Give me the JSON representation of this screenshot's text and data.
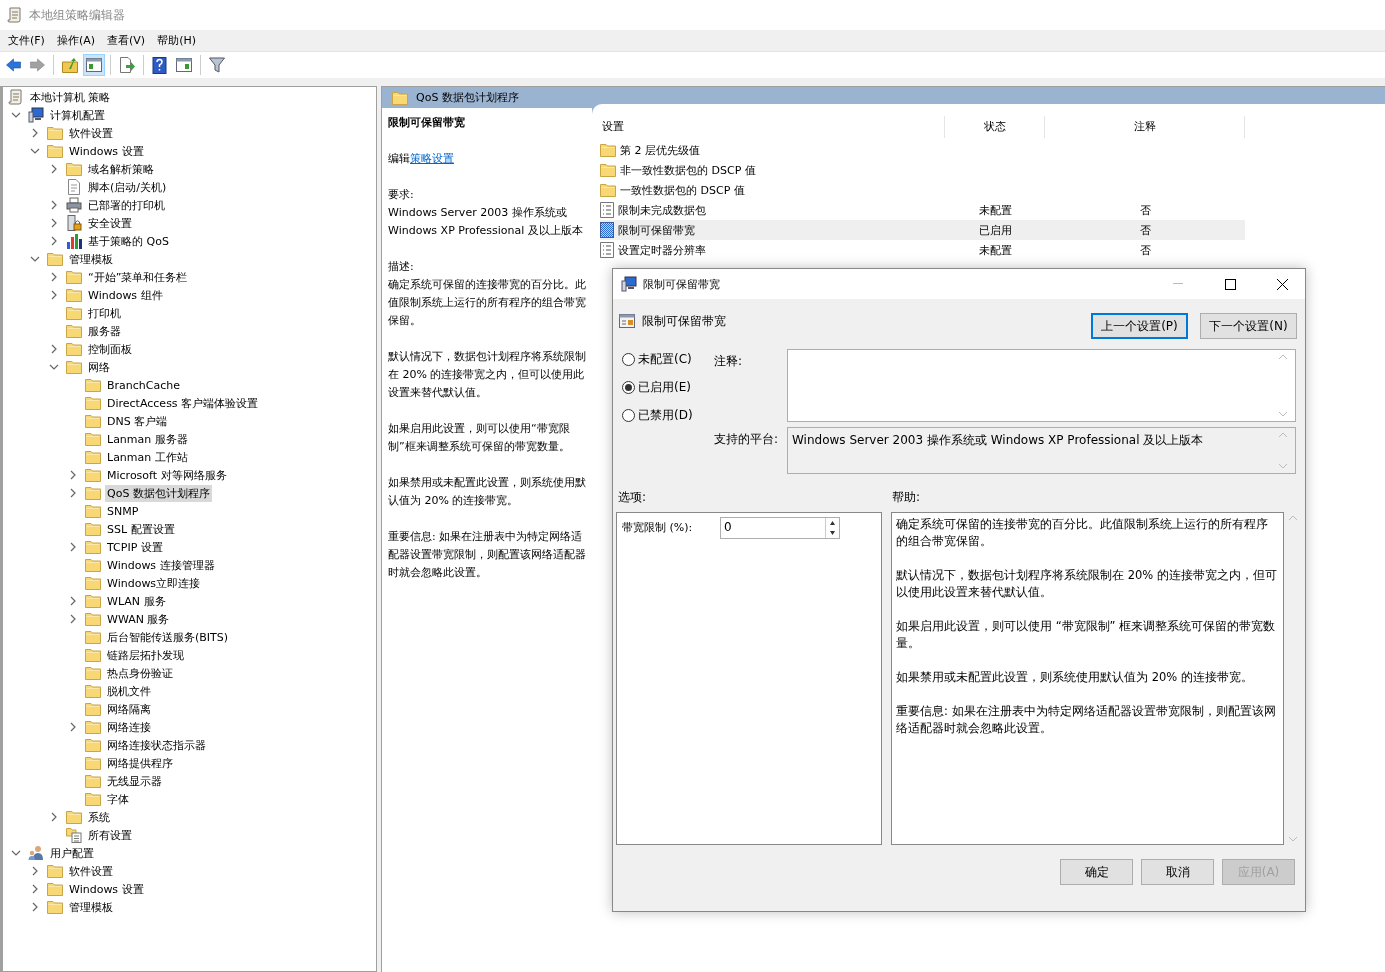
{
  "window": {
    "title": "本地组策略编辑器"
  },
  "menu": [
    {
      "label": "文件(F)"
    },
    {
      "label": "操作(A)"
    },
    {
      "label": "查看(V)"
    },
    {
      "label": "帮助(H)"
    }
  ],
  "toolbar": [
    [
      {
        "kind": "back",
        "disabled": false,
        "pressed": false
      },
      {
        "kind": "forward",
        "disabled": true,
        "pressed": false
      }
    ],
    [
      {
        "kind": "up",
        "disabled": false,
        "pressed": false
      },
      {
        "kind": "console-tree",
        "disabled": false,
        "pressed": true
      }
    ],
    [
      {
        "kind": "export",
        "disabled": false,
        "pressed": false
      }
    ],
    [
      {
        "kind": "help",
        "disabled": false,
        "pressed": false
      },
      {
        "kind": "action-pane",
        "disabled": false,
        "pressed": false
      }
    ],
    [
      {
        "kind": "filter",
        "disabled": false,
        "pressed": false
      }
    ]
  ],
  "tree": [
    {
      "label": "本地计算机 策略",
      "kind": "policy-root",
      "selected": false,
      "children": [
        {
          "label": "计算机配置",
          "kind": "computer",
          "selected": false,
          "expanded": true,
          "children": [
            {
              "label": "软件设置",
              "kind": "folder",
              "selected": false,
              "expanded": false
            },
            {
              "label": "Windows 设置",
              "kind": "folder",
              "selected": false,
              "expanded": true,
              "children": [
                {
                  "label": "域名解析策略",
                  "kind": "folder",
                  "selected": false,
                  "expanded": false
                },
                {
                  "label": "脚本(启动/关机)",
                  "kind": "script",
                  "selected": false
                },
                {
                  "label": "已部署的打印机",
                  "kind": "printer",
                  "selected": false,
                  "expanded": false
                },
                {
                  "label": "安全设置",
                  "kind": "security",
                  "selected": false,
                  "expanded": false
                },
                {
                  "label": "基于策略的 QoS",
                  "kind": "chart",
                  "selected": false,
                  "expanded": false
                }
              ]
            },
            {
              "label": "管理模板",
              "kind": "folder",
              "selected": false,
              "expanded": true,
              "children": [
                {
                  "label": "“开始”菜单和任务栏",
                  "kind": "folder",
                  "selected": false,
                  "expanded": false
                },
                {
                  "label": "Windows 组件",
                  "kind": "folder",
                  "selected": false,
                  "expanded": false
                },
                {
                  "label": "打印机",
                  "kind": "folder",
                  "selected": false
                },
                {
                  "label": "服务器",
                  "kind": "folder",
                  "selected": false
                },
                {
                  "label": "控制面板",
                  "kind": "folder",
                  "selected": false,
                  "expanded": false
                },
                {
                  "label": "网络",
                  "kind": "folder",
                  "selected": false,
                  "expanded": true,
                  "children": [
                    {
                      "label": "BranchCache",
                      "kind": "folder",
                      "selected": false
                    },
                    {
                      "label": "DirectAccess 客户端体验设置",
                      "kind": "folder",
                      "selected": false
                    },
                    {
                      "label": "DNS 客户端",
                      "kind": "folder",
                      "selected": false
                    },
                    {
                      "label": "Lanman 服务器",
                      "kind": "folder",
                      "selected": false
                    },
                    {
                      "label": "Lanman 工作站",
                      "kind": "folder",
                      "selected": false
                    },
                    {
                      "label": "Microsoft 对等网络服务",
                      "kind": "folder",
                      "selected": false,
                      "expanded": false
                    },
                    {
                      "label": "QoS 数据包计划程序",
                      "kind": "folder",
                      "selected": true,
                      "expanded": false
                    },
                    {
                      "label": "SNMP",
                      "kind": "folder",
                      "selected": false
                    },
                    {
                      "label": "SSL 配置设置",
                      "kind": "folder",
                      "selected": false
                    },
                    {
                      "label": "TCPIP 设置",
                      "kind": "folder",
                      "selected": false,
                      "expanded": false
                    },
                    {
                      "label": "Windows 连接管理器",
                      "kind": "folder",
                      "selected": false
                    },
                    {
                      "label": "Windows立即连接",
                      "kind": "folder",
                      "selected": false
                    },
                    {
                      "label": "WLAN 服务",
                      "kind": "folder",
                      "selected": false,
                      "expanded": false
                    },
                    {
                      "label": "WWAN 服务",
                      "kind": "folder",
                      "selected": false,
                      "expanded": false
                    },
                    {
                      "label": "后台智能传送服务(BITS)",
                      "kind": "folder",
                      "selected": false
                    },
                    {
                      "label": "链路层拓扑发现",
                      "kind": "folder",
                      "selected": false
                    },
                    {
                      "label": "热点身份验证",
                      "kind": "folder",
                      "selected": false
                    },
                    {
                      "label": "脱机文件",
                      "kind": "folder",
                      "selected": false
                    },
                    {
                      "label": "网络隔离",
                      "kind": "folder",
                      "selected": false
                    },
                    {
                      "label": "网络连接",
                      "kind": "folder",
                      "selected": false,
                      "expanded": false
                    },
                    {
                      "label": "网络连接状态指示器",
                      "kind": "folder",
                      "selected": false
                    },
                    {
                      "label": "网络提供程序",
                      "kind": "folder",
                      "selected": false
                    },
                    {
                      "label": "无线显示器",
                      "kind": "folder",
                      "selected": false
                    },
                    {
                      "label": "字体",
                      "kind": "folder",
                      "selected": false
                    }
                  ]
                },
                {
                  "label": "系统",
                  "kind": "folder",
                  "selected": false,
                  "expanded": false
                },
                {
                  "label": "所有设置",
                  "kind": "all-settings",
                  "selected": false
                }
              ]
            }
          ]
        },
        {
          "label": "用户配置",
          "kind": "user",
          "selected": false,
          "expanded": true,
          "children": [
            {
              "label": "软件设置",
              "kind": "folder",
              "selected": false,
              "expanded": false
            },
            {
              "label": "Windows 设置",
              "kind": "folder",
              "selected": false,
              "expanded": false
            },
            {
              "label": "管理模板",
              "kind": "folder",
              "selected": false,
              "expanded": false
            }
          ]
        }
      ]
    }
  ],
  "pane": {
    "title": "QoS 数据包计划程序"
  },
  "details": {
    "heading": "限制可保留带宽",
    "edit_prefix": "编辑",
    "edit_link": "策略设置",
    "requirements_label": "要求:",
    "requirements": "Windows Server 2003 操作系统或 Windows XP Professional 及以上版本",
    "description_label": "描述:",
    "paragraphs": [
      "确定系统可保留的连接带宽的百分比。此值限制系统上运行的所有程序的组合带宽保留。",
      "默认情况下，数据包计划程序将系统限制在 20% 的连接带宽之内，但可以使用此设置来替代默认值。",
      "如果启用此设置，则可以使用“带宽限制”框来调整系统可保留的带宽数量。",
      "如果禁用或未配置此设置，则系统使用默认值为 20% 的连接带宽。",
      "重要信息: 如果在注册表中为特定网络适配器设置带宽限制，则配置该网络适配器时就会忽略此设置。"
    ]
  },
  "table": {
    "columns": [
      "设置",
      "状态",
      "注释"
    ],
    "rows": [
      {
        "kind": "folder",
        "name": "第 2 层优先级值",
        "selected": false
      },
      {
        "kind": "folder",
        "name": "非一致性数据包的 DSCP 值",
        "selected": false
      },
      {
        "kind": "folder",
        "name": "一致性数据包的 DSCP 值",
        "selected": false
      },
      {
        "kind": "setting",
        "name": "限制未完成数据包",
        "state": "未配置",
        "comment": "否",
        "selected": false
      },
      {
        "kind": "setting-enabled",
        "name": "限制可保留带宽",
        "state": "已启用",
        "comment": "否",
        "selected": true
      },
      {
        "kind": "setting",
        "name": "设置定时器分辨率",
        "state": "未配置",
        "comment": "否",
        "selected": false
      }
    ]
  },
  "dialog": {
    "title": "限制可保留带宽",
    "setting_name": "限制可保留带宽",
    "nav_buttons": [
      {
        "label": "上一个设置(P)",
        "focused": true
      },
      {
        "label": "下一个设置(N)",
        "focused": false
      }
    ],
    "options": [
      {
        "label": "未配置(C)",
        "selected": false
      },
      {
        "label": "已启用(E)",
        "selected": true
      },
      {
        "label": "已禁用(D)",
        "selected": false
      }
    ],
    "comment_label": "注释:",
    "platform_label": "支持的平台:",
    "platform": "Windows Server 2003 操作系统或 Windows XP Professional 及以上版本",
    "options_label": "选项:",
    "help_label": "帮助:",
    "option_field": {
      "label": "带宽限制 (%):",
      "value": "0"
    },
    "help": [
      "确定系统可保留的连接带宽的百分比。此值限制系统上运行的所有程序的组合带宽保留。",
      "默认情况下，数据包计划程序将系统限制在 20% 的连接带宽之内，但可以使用此设置来替代默认值。",
      "如果启用此设置，则可以使用 “带宽限制” 框来调整系统可保留的带宽数量。",
      "如果禁用或未配置此设置，则系统使用默认值为 20% 的连接带宽。",
      "重要信息: 如果在注册表中为特定网络适配器设置带宽限制，则配置该网络适配器时就会忽略此设置。"
    ],
    "buttons": [
      {
        "label": "确定",
        "disabled": false
      },
      {
        "label": "取消",
        "disabled": false
      },
      {
        "label": "应用(A)",
        "disabled": true
      }
    ]
  }
}
